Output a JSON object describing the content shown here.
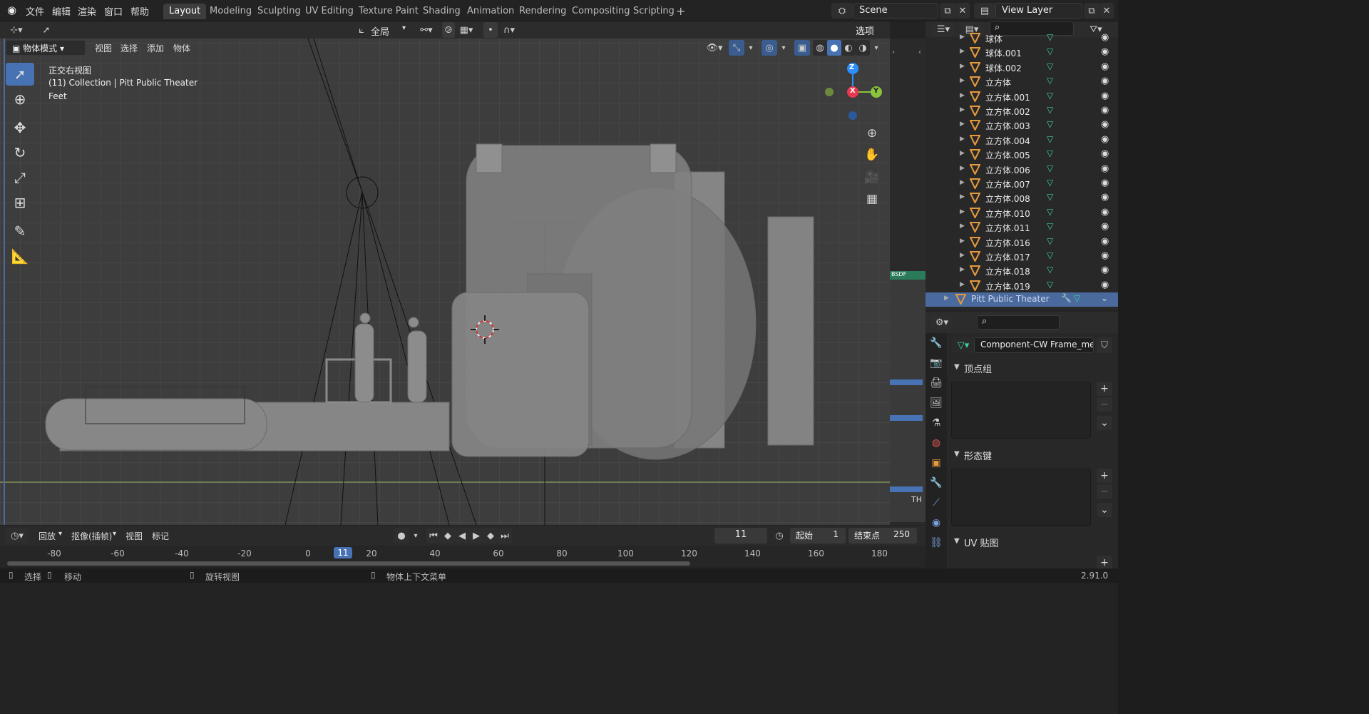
{
  "topbar": {
    "menus": [
      "文件",
      "编辑",
      "渲染",
      "窗口",
      "帮助"
    ],
    "workspaces": [
      "Layout",
      "Modeling",
      "Sculpting",
      "UV Editing",
      "Texture Paint",
      "Shading",
      "Animation",
      "Rendering",
      "Compositing",
      "Scripting"
    ],
    "active_workspace": "Layout",
    "add_tab": "+",
    "scene": "Scene",
    "view_layer": "View Layer"
  },
  "header": {
    "transform_orientation": "全局",
    "options": "选项",
    "mode": "物体模式",
    "menus": [
      "视图",
      "选择",
      "添加",
      "物体"
    ]
  },
  "viewport": {
    "view_name": "正交右视图",
    "collection": "(11) Collection | Pitt Public Theater",
    "units": "Feet",
    "gizmo": {
      "z": "Z",
      "x": "X",
      "y": "Y"
    }
  },
  "timeline": {
    "menus": [
      "回放",
      "抠像(插帧)",
      "视图",
      "标记"
    ],
    "current_frame": "11",
    "start_label": "起始",
    "start": "1",
    "end_label": "结束点",
    "end": "250",
    "ticks": [
      "-80",
      "-60",
      "-40",
      "-20",
      "0",
      "11",
      "20",
      "40",
      "60",
      "80",
      "100",
      "120",
      "140",
      "160",
      "180"
    ]
  },
  "statusbar": {
    "select": "选择",
    "move": "移动",
    "rotate": "旋转视图",
    "context": "物体上下文菜单",
    "version": "2.91.0"
  },
  "outliner": {
    "rows": [
      {
        "name": "球体"
      },
      {
        "name": "球体.001"
      },
      {
        "name": "球体.002"
      },
      {
        "name": "立方体"
      },
      {
        "name": "立方体.001"
      },
      {
        "name": "立方体.002"
      },
      {
        "name": "立方体.003"
      },
      {
        "name": "立方体.004"
      },
      {
        "name": "立方体.005"
      },
      {
        "name": "立方体.006"
      },
      {
        "name": "立方体.007"
      },
      {
        "name": "立方体.008"
      },
      {
        "name": "立方体.010"
      },
      {
        "name": "立方体.011"
      },
      {
        "name": "立方体.016"
      },
      {
        "name": "立方体.017"
      },
      {
        "name": "立方体.018"
      },
      {
        "name": "立方体.019"
      }
    ],
    "selected": "Pitt Public Theater"
  },
  "properties": {
    "mesh_name": "Component-CW Frame_mesh_",
    "panels": [
      "顶点组",
      "形态键",
      "UV 贴图"
    ]
  },
  "strip": {
    "bsdf": "BSDF",
    "th": "TH"
  },
  "colors": {
    "accent": "#4772b3",
    "x_axis": "#e8394e",
    "y_axis": "#8ac33e",
    "z_axis": "#2c8fff",
    "mesh_icon": "#e59a3c",
    "data_icon": "#3ed096"
  }
}
